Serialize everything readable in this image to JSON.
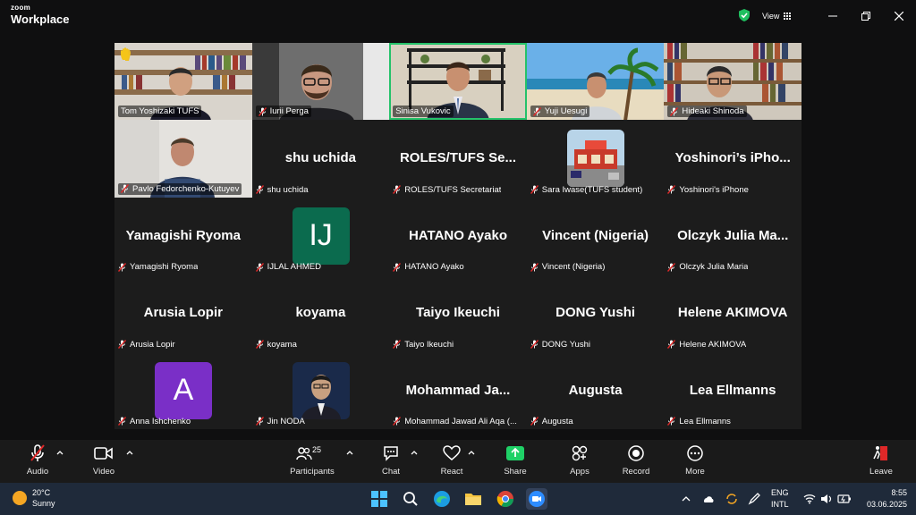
{
  "app": {
    "brand_top": "zoom",
    "brand_bottom": "Workplace",
    "view_label": "View"
  },
  "tiles": [
    {
      "name": "Tom Yoshizaki TUFS",
      "type": "video",
      "scene": "shelf",
      "muted": false
    },
    {
      "name": "Iurii Perga",
      "type": "video",
      "scene": "room",
      "muted": true
    },
    {
      "name": "Sinisa Vukovic",
      "type": "video",
      "scene": "office",
      "muted": false,
      "active": true
    },
    {
      "name": "Yuji Uesugi",
      "type": "video",
      "scene": "beach",
      "muted": true
    },
    {
      "name": "Hideaki Shinoda",
      "type": "video",
      "scene": "shelf2",
      "muted": true
    },
    {
      "name": "Pavlo Fedorchenko-Kutuyev",
      "type": "video",
      "scene": "wall",
      "muted": true
    },
    {
      "name": "shu uchida",
      "display": "shu uchida",
      "type": "name",
      "muted": true
    },
    {
      "name": "ROLES/TUFS Secretariat",
      "display": "ROLES/TUFS  Se...",
      "type": "name",
      "muted": true
    },
    {
      "name": "Sara Iwase(TUFS student)",
      "type": "photo",
      "muted": true
    },
    {
      "name": "Yoshinori's iPhone",
      "display": "Yoshinori’s  iPho...",
      "type": "name",
      "muted": true
    },
    {
      "name": "Yamagishi Ryoma",
      "display": "Yamagishi Ryoma",
      "type": "name",
      "muted": true
    },
    {
      "name": "IJLAL AHMED",
      "type": "avatar",
      "initials": "IJ",
      "color": "#0b6b4e",
      "muted": true
    },
    {
      "name": "HATANO Ayako",
      "display": "HATANO Ayako",
      "type": "name",
      "muted": true
    },
    {
      "name": "Vincent (Nigeria)",
      "display": "Vincent (Nigeria)",
      "type": "name",
      "muted": true
    },
    {
      "name": "Olczyk Julia Maria",
      "display": "Olczyk Julia Ma...",
      "type": "name",
      "muted": true
    },
    {
      "name": "Arusia Lopir",
      "display": "Arusia Lopir",
      "type": "name",
      "muted": true
    },
    {
      "name": "koyama",
      "display": "koyama",
      "type": "name",
      "muted": true
    },
    {
      "name": "Taiyo Ikeuchi",
      "display": "Taiyo Ikeuchi",
      "type": "name",
      "muted": true
    },
    {
      "name": "DONG Yushi",
      "display": "DONG Yushi",
      "type": "name",
      "muted": true
    },
    {
      "name": "Helene AKIMOVA",
      "display": "Helene AKIMOVA",
      "type": "name",
      "muted": true
    },
    {
      "name": "Anna Ishchenko",
      "type": "avatar",
      "initials": "A",
      "color": "#7a2fc7",
      "muted": true
    },
    {
      "name": "Jin NODA",
      "type": "photo2",
      "muted": true
    },
    {
      "name": "Mohammad Jawad Ali Aqa (...",
      "display": "Mohammad  Ja...",
      "type": "name",
      "muted": true
    },
    {
      "name": "Augusta",
      "display": "Augusta",
      "type": "name",
      "muted": true
    },
    {
      "name": "Lea Ellmanns",
      "display": "Lea Ellmanns",
      "type": "name",
      "muted": true
    }
  ],
  "toolbar": {
    "audio": "Audio",
    "video": "Video",
    "participants": "Participants",
    "participants_count": "25",
    "chat": "Chat",
    "react": "React",
    "share": "Share",
    "apps": "Apps",
    "record": "Record",
    "more": "More",
    "leave": "Leave"
  },
  "taskbar": {
    "temp": "20°C",
    "weather": "Sunny",
    "lang_top": "ENG",
    "lang_bottom": "INTL",
    "time": "8:55",
    "date": "03.06.2025"
  },
  "colors": {
    "active_border": "#25c26a",
    "share": "#1fd167",
    "mute": "#e02828"
  }
}
